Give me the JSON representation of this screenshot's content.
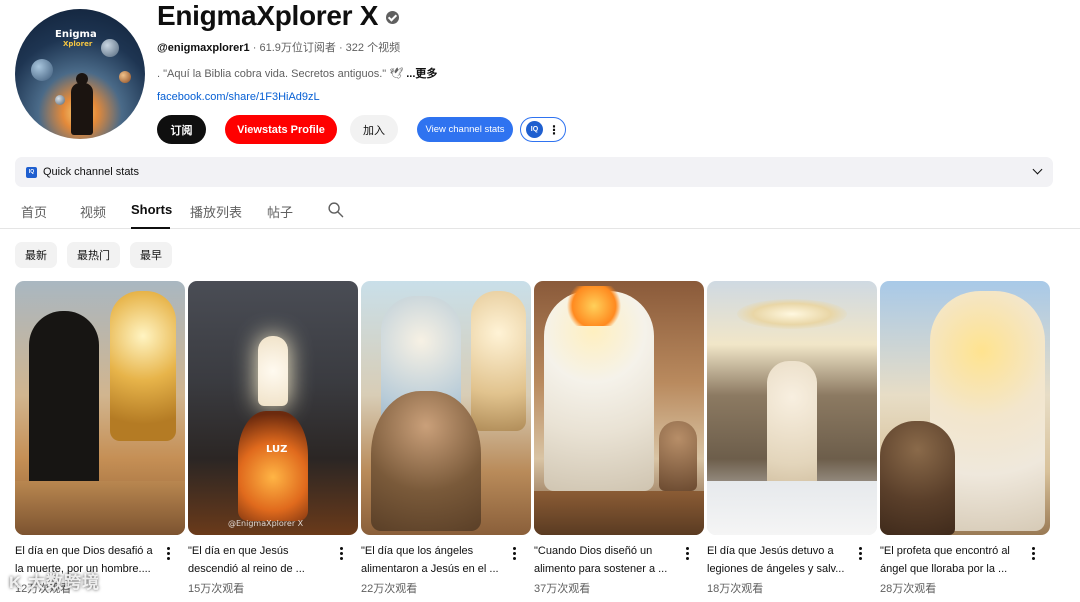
{
  "channel": {
    "name": "EnigmaXplorer X",
    "avatar_logo_line1": "Enigma",
    "avatar_logo_line2": "Xplorer",
    "handle": "@enigmaxplorer1",
    "subscribers": "61.9万位订阅者",
    "video_count": "322 个视频",
    "description": ". \"Aquí la Biblia cobra vida. Secretos antiguos.\" 🕊",
    "description_more": "...更多",
    "link": "facebook.com/share/1F3HiAd9zL"
  },
  "actions": {
    "subscribe": "订阅",
    "viewstats_profile": "Viewstats Profile",
    "join": "加入",
    "view_channel_stats": "View channel stats",
    "ext_logo": "IQ"
  },
  "quick_stats": {
    "logo": "IQ",
    "label": "Quick channel stats"
  },
  "tabs": [
    {
      "label": "首页"
    },
    {
      "label": "视频"
    },
    {
      "label": "Shorts",
      "active": true
    },
    {
      "label": "播放列表"
    },
    {
      "label": "帖子"
    }
  ],
  "chips": [
    "最新",
    "最热门",
    "最早"
  ],
  "shorts": [
    {
      "title_line1": "El día en que Dios desafió a",
      "title_line2": "la muerte, por un hombre....",
      "views": "12万次观看",
      "overlay": ""
    },
    {
      "title_line1": "\"El día en que Jesús",
      "title_line2": "descendió al reino de ...",
      "views": "15万次观看",
      "overlay": "LUZ",
      "overlay2": "@EnigmaXplorer X"
    },
    {
      "title_line1": "\"El día que los ángeles",
      "title_line2": "alimentaron a Jesús en el ...",
      "views": "22万次观看",
      "overlay": ""
    },
    {
      "title_line1": "\"Cuando Dios diseñó un",
      "title_line2": "alimento para sostener a ...",
      "views": "37万次观看",
      "overlay": ""
    },
    {
      "title_line1": "El día que Jesús detuvo a",
      "title_line2": "legiones de ángeles y salv...",
      "views": "18万次观看",
      "overlay": ""
    },
    {
      "title_line1": "\"El profeta que encontró al",
      "title_line2": "ángel que lloraba por la ...",
      "views": "28万次观看",
      "overlay": ""
    }
  ],
  "watermark": "K 大数跨境",
  "colors": {
    "subscribe_bg": "#0f0f0f",
    "viewstats_bg": "#ff0000",
    "stats_blue": "#2f73f0",
    "link_blue": "#065fd4"
  }
}
